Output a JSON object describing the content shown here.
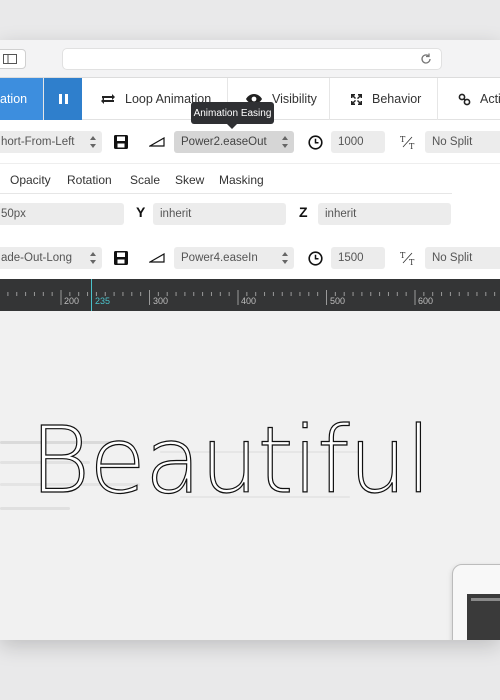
{
  "browser": {
    "url": ""
  },
  "tabs": {
    "active_label": "ation",
    "items": [
      {
        "label": "Loop Animation",
        "icon": "loop-icon"
      },
      {
        "label": "Visibility",
        "icon": "eye-icon"
      },
      {
        "label": "Behavior",
        "icon": "expand-icon"
      },
      {
        "label": "Acti",
        "icon": "link-icon"
      }
    ]
  },
  "tooltip": "Animation Easing",
  "transition_in": {
    "preset": "hort-From-Left",
    "easing": "Power2.easeOut",
    "duration": "1000",
    "split": "No Split"
  },
  "subtabs": [
    "Opacity",
    "Rotation",
    "Scale",
    "Skew",
    "Masking"
  ],
  "transform": {
    "x_value": "50px",
    "y_label": "Y",
    "y_value": "inherit",
    "z_label": "Z",
    "z_value": "inherit"
  },
  "transition_out": {
    "preset": "ade-Out-Long",
    "easing": "Power4.easeIn",
    "duration": "1500",
    "split": "No Split"
  },
  "timeline": {
    "labels": [
      "200",
      "235",
      "300",
      "400",
      "500",
      "600"
    ],
    "current": "235"
  },
  "stage": {
    "headline": "Beautiful"
  },
  "colors": {
    "accent": "#3d8ede",
    "timeline_bg": "#343536",
    "cursor": "#4bc3cc"
  }
}
